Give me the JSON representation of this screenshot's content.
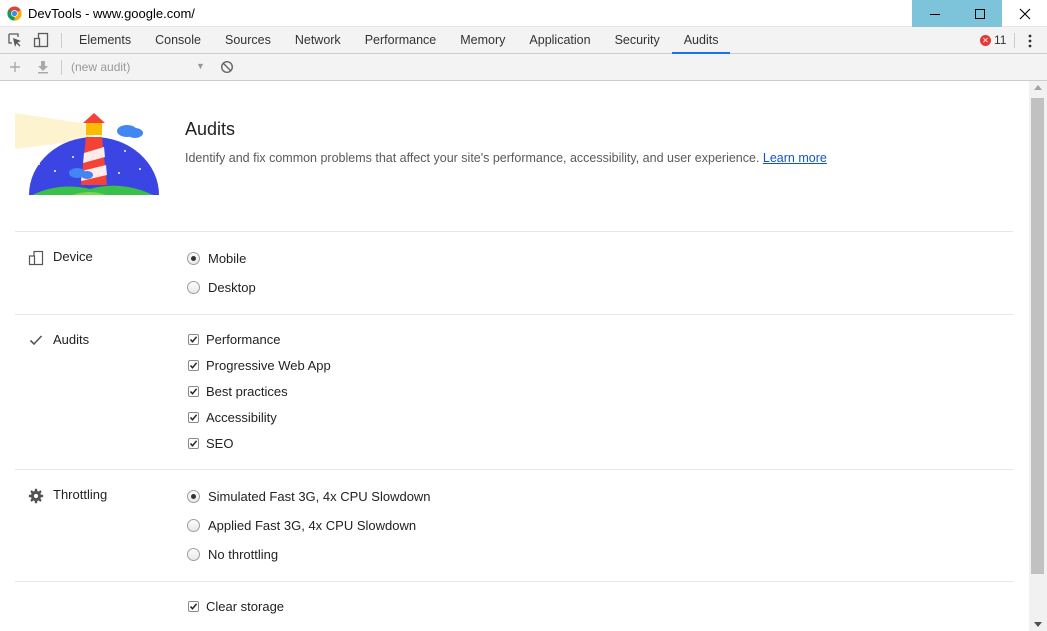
{
  "window": {
    "title": "DevTools - www.google.com/"
  },
  "tabs": [
    {
      "label": "Elements"
    },
    {
      "label": "Console"
    },
    {
      "label": "Sources"
    },
    {
      "label": "Network"
    },
    {
      "label": "Performance"
    },
    {
      "label": "Memory"
    },
    {
      "label": "Application"
    },
    {
      "label": "Security"
    },
    {
      "label": "Audits",
      "active": true
    }
  ],
  "errors": {
    "count": "11",
    "color": "#e53935"
  },
  "audit_toolbar": {
    "selector": "(new audit)"
  },
  "header": {
    "title": "Audits",
    "description": "Identify and fix common problems that affect your site's performance, accessibility, and user experience.",
    "learn_more": "Learn more"
  },
  "sections": {
    "device": {
      "label": "Device",
      "icon": "device-icon",
      "options": [
        {
          "label": "Mobile",
          "selected": true
        },
        {
          "label": "Desktop",
          "selected": false
        }
      ]
    },
    "audits": {
      "label": "Audits",
      "icon": "checkmark-icon",
      "options": [
        {
          "label": "Performance",
          "checked": true
        },
        {
          "label": "Progressive Web App",
          "checked": true
        },
        {
          "label": "Best practices",
          "checked": true
        },
        {
          "label": "Accessibility",
          "checked": true
        },
        {
          "label": "SEO",
          "checked": true
        }
      ]
    },
    "throttling": {
      "label": "Throttling",
      "icon": "gear-icon",
      "options": [
        {
          "label": "Simulated Fast 3G, 4x CPU Slowdown",
          "selected": true
        },
        {
          "label": "Applied Fast 3G, 4x CPU Slowdown",
          "selected": false
        },
        {
          "label": "No throttling",
          "selected": false
        }
      ]
    },
    "storage": {
      "options": [
        {
          "label": "Clear storage",
          "checked": true
        }
      ]
    }
  },
  "colors": {
    "accent": "#1a73e8",
    "window_button_hover": "#7dc4da",
    "link": "#1155cc"
  }
}
